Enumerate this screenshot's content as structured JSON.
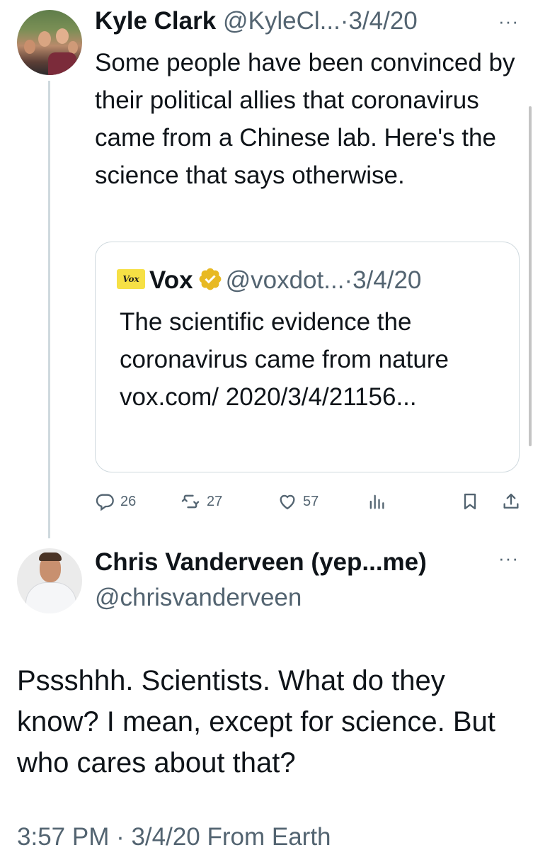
{
  "parent_tweet": {
    "author_name": "Kyle Clark",
    "author_handle": "@KyleCl...",
    "separator": "·",
    "date": "3/4/20",
    "more": "···",
    "text": "Some people have been convinced by their political allies that coronavirus came from a Chinese lab. Here's the science that says otherwise.",
    "quote": {
      "logo_text": "Vox",
      "author_name": "Vox",
      "author_handle": "@voxdot...",
      "separator": "·",
      "date": "3/4/20",
      "text": "The scientific evidence the coronavirus came from nature vox.com/ 2020/3/4/21156..."
    },
    "actions": {
      "replies": "26",
      "retweets": "27",
      "likes": "57"
    }
  },
  "reply": {
    "author_name": "Chris Vanderveen (yep...me)",
    "author_handle": "@chrisvanderveen",
    "more": "···",
    "text": "Pssshhh.  Scientists.  What do they know?  I mean, except for science. But who cares about that?",
    "timestamp": "3:57 PM · 3/4/20 From Earth"
  },
  "colors": {
    "text_primary": "#0f1419",
    "text_secondary": "#536471",
    "border": "#cfd9de",
    "verified_gold": "#e8b923",
    "vox_yellow": "#f6e045"
  }
}
